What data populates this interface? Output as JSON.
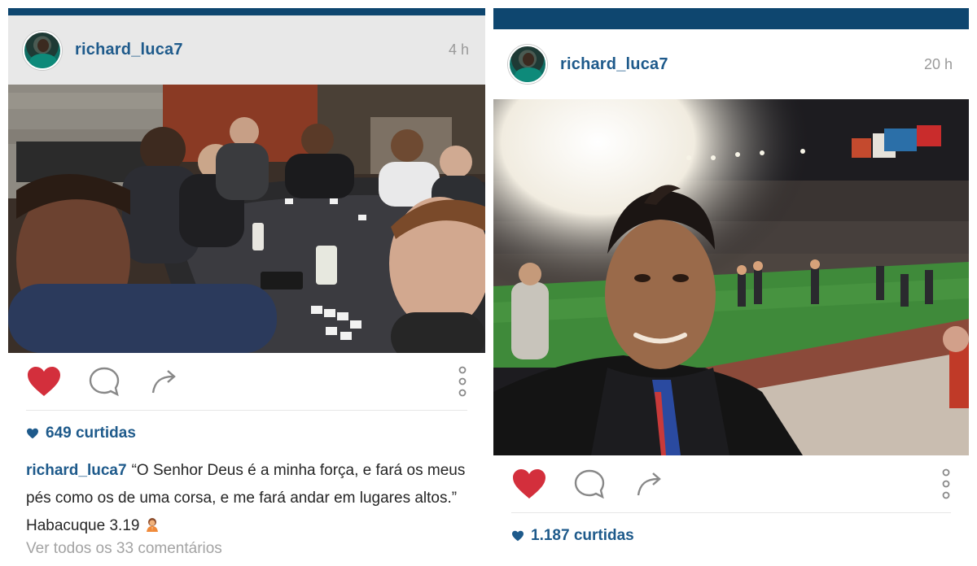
{
  "posts": [
    {
      "username": "richard_luca7",
      "time": "4 h",
      "likes": "649 curtidas",
      "caption_user": "richard_luca7",
      "caption_text": "“O Senhor Deus é a minha força, e fará os meus pés como os de uma corsa, e me fará andar em lugares altos.” Habacuque 3.19",
      "comments_link": "Ver todos os 33 comentários",
      "liked": true,
      "photo_description_icon": "group-poker-selfie-photo"
    },
    {
      "username": "richard_luca7",
      "time": "20 h",
      "likes": "1.187 curtidas",
      "liked": true,
      "photo_description_icon": "stadium-selfie-photo"
    }
  ],
  "colors": {
    "status_bar": "#0e466f",
    "username": "#1e5a8b",
    "like_red": "#d32f3c",
    "muted": "#9a9a9a"
  },
  "icons": [
    "heart-icon",
    "comment-icon",
    "share-icon",
    "more-options-icon",
    "small-heart-icon"
  ]
}
